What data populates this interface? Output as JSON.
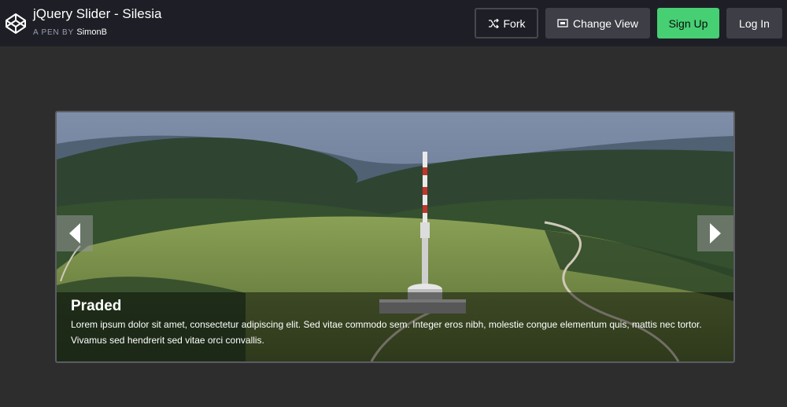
{
  "header": {
    "title": "jQuery Slider - Silesia",
    "byline_prefix": "A PEN BY",
    "author": "SimonB",
    "buttons": {
      "fork": "Fork",
      "change_view": "Change View",
      "sign_up": "Sign Up",
      "log_in": "Log In"
    },
    "colors": {
      "bar": "#1e1f26",
      "sign_up": "#47cf73"
    }
  },
  "slider": {
    "slide_title": "Praded",
    "slide_text": "Lorem ipsum dolor sit amet, consectetur adipiscing elit. Sed vitae commodo sem. Integer eros nibh, molestie congue elementum quis, mattis nec tortor. Vivamus sed hendrerit sed vitae orci convallis.",
    "icons": {
      "prev": "chevron-left-icon",
      "next": "chevron-right-icon"
    }
  }
}
